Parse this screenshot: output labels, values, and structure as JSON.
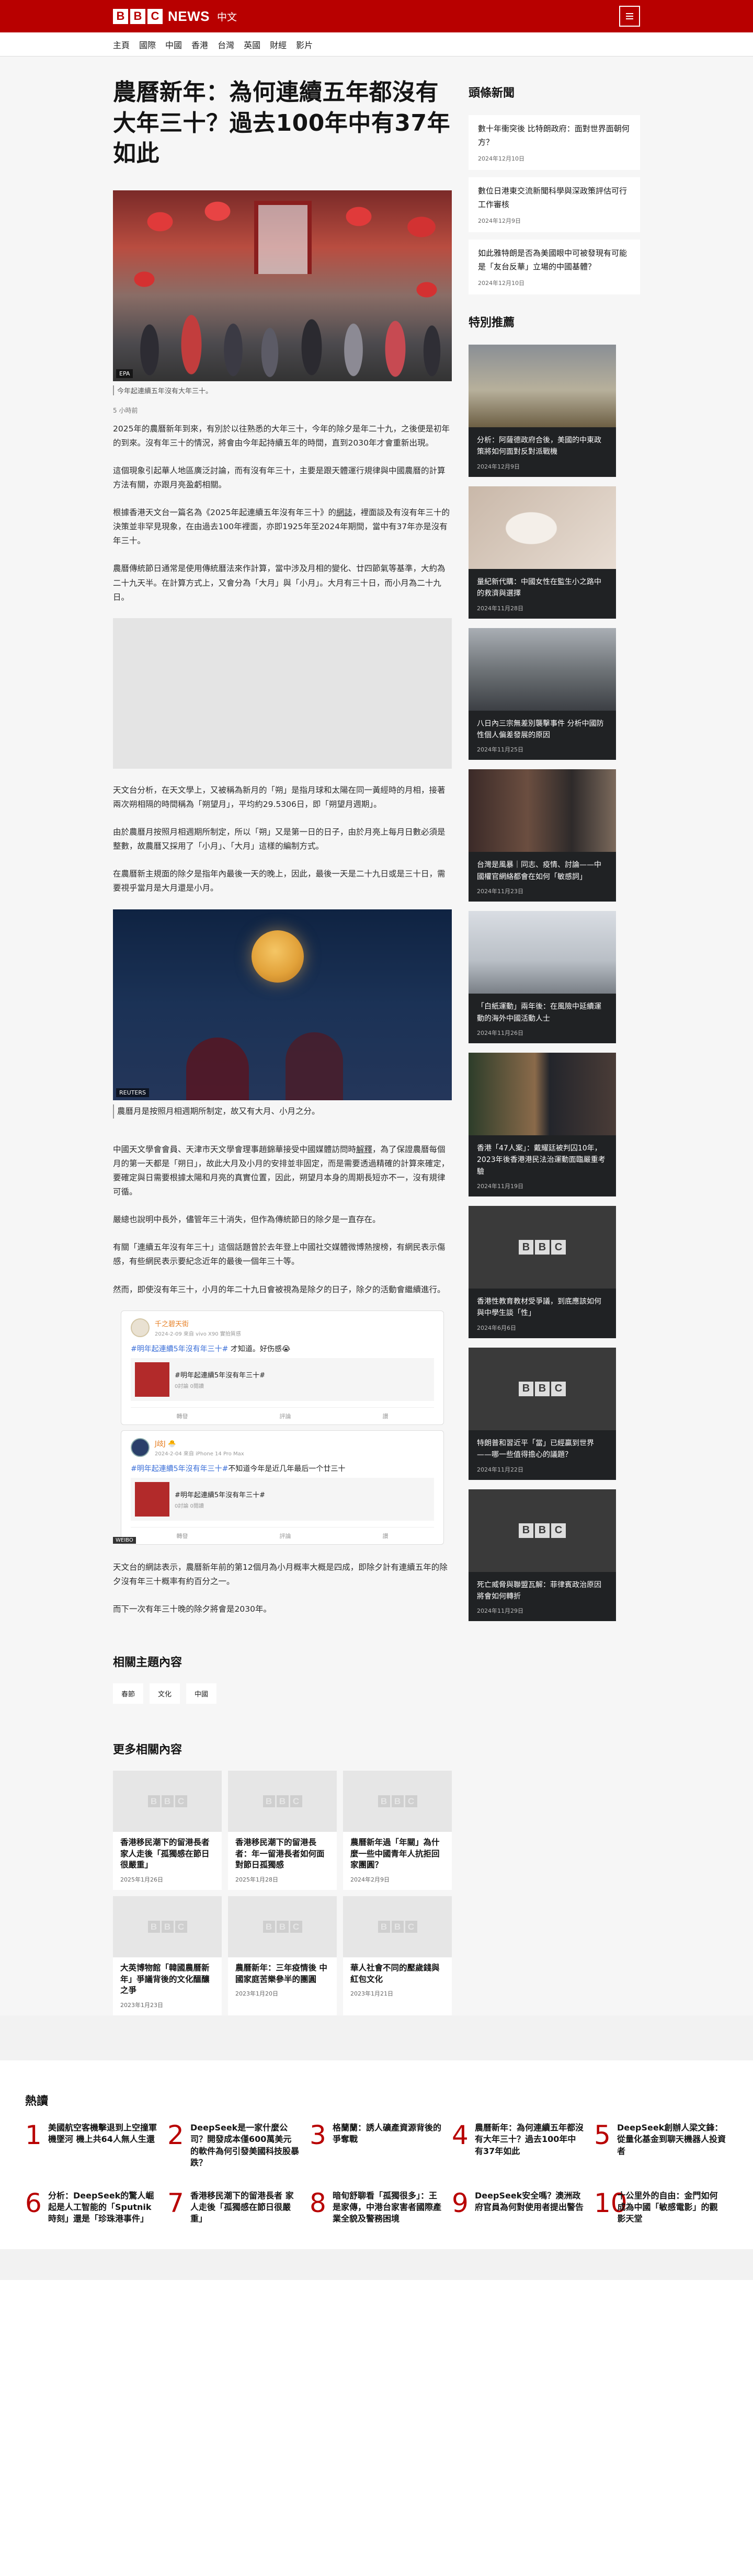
{
  "header": {
    "bbc_letters": [
      "B",
      "B",
      "C"
    ],
    "news_label": "NEWS",
    "lang_label": "中文",
    "menu_icon": "hamburger-icon"
  },
  "nav": [
    "主頁",
    "國際",
    "中國",
    "香港",
    "台灣",
    "英國",
    "財經",
    "影片"
  ],
  "article": {
    "title": "農曆新年：為何連續五年都沒有大年三十？過去100年中有37年如此",
    "hero_credit": "EPA",
    "hero_caption": "今年起連續五年沒有大年三十。",
    "byline": "5 小時前",
    "paragraphs_a": [
      "2025年的農曆新年到來，有別於以往熟悉的大年三十，今年的除夕是年二十九，之後便是初年的到來。沒有年三十的情況，將會由今年起持續五年的時間，直到2030年才會重新出現。",
      "這個現象引起華人地區廣泛討論，而有沒有年三十，主要是跟天體運行規律與中國農曆的計算方法有關，亦跟月亮盈虧相關。",
      "根據香港天文台一篇名為《2025年起連續五年沒有年三十》的",
      "網誌",
      "，裡面談及有沒有年三十的決策並非罕見現象，在由過去100年裡面，亦即1925年至2024年期間，當中有37年亦是沒有年三十。",
      "農曆傳統節日通常是使用傳統曆法來作計算，當中涉及月相的變化、廿四節氣等基準，大約為二十九天半。在計算方式上，又會分為「大月」與「小月」。大月有三十日，而小月為二十九日。"
    ],
    "paragraphs_b": [
      "天文台分析，在天文學上，又被稱為新月的「朔」是指月球和太陽在同一黃經時的月相，接著兩次朔相隔的時間稱為「朔望月」，平均約29.5306日，即「朔望月週期」。",
      "由於農曆月按照月相週期所制定，所以「朔」又是第一日的日子，由於月亮上每月日數必須是整數，故農曆又採用了「小月」、「大月」這樣的編制方式。",
      "在農曆新主規面的除夕是指年內最後一天的晚上，因此，最後一天是二十九日或是三十日，需要視乎當月是大月還是小月。"
    ],
    "moon_credit": "REUTERS",
    "moon_caption": "農曆月是按照月相週期所制定，故又有大月、小月之分。",
    "paragraphs_c": [
      "中國天文學會會員、天津市天文學會理事趙錦華接受中國媒體訪問時",
      "解釋",
      "，為了保證農曆每個月的第一天都是「朔日」，故此大月及小月的安排並非固定，而是需要透過精確的計算來確定，要確定與日需要根據太陽和月亮的真實位置，因此，朔望月本身的周期長短亦不一，沒有規律可循。",
      "嚴總也說明中長外，儘管年三十消失，但作為傳統節日的除夕是一直存在。",
      "有關「連續五年沒有年三十」這個話題曾於去年登上中國社交媒體微博熱搜榜，有網民表示傷感，有些網民表示要紀念近年的最後一個年三十等。",
      "然而，即使沒有年三十，小月的年二十九日會被視為是除夕的日子，除夕的活動會繼續進行。"
    ],
    "embeds": [
      {
        "user": "千之碧天街",
        "meta": "2024-2-09 來自 vivo X90 實拍質感",
        "tag": "#明年起連續5年沒有年三十#",
        "text": " 才知道。好伤感😭",
        "card_title": "#明年起連續5年沒有年三十#",
        "card_sub": "0討論 0閱讀",
        "forward": "轉發",
        "comment": "評論",
        "like": "讚"
      },
      {
        "user": "J歧J 🐣",
        "meta": "2024-2-04 來自 iPhone 14 Pro Max",
        "tag": "#明年起連續5年沒有年三十#",
        "text": "不知道今年是近几年最后一个廿三十",
        "card_title": "#明年起連續5年沒有年三十#",
        "card_sub": "0討論 0閱讀",
        "forward": "轉發",
        "comment": "評論",
        "like": "讚"
      }
    ],
    "weibo_label": "WEIBO",
    "paragraphs_d": [
      "天文台的網誌表示，農曆新年前的第12個月為小月概率大概是四成，即除夕計有連續五年的除夕沒有年三十概率有約百分之一。",
      "而下一次有年三十晚的除夕將會是2030年。"
    ]
  },
  "topics": {
    "title": "相關主題內容",
    "tags": [
      "春節",
      "文化",
      "中國"
    ]
  },
  "related": {
    "title": "更多相關內容",
    "items": [
      {
        "title": "香港移民潮下的留港長者 家人走後「孤獨感在節日很嚴重」",
        "date": "2025年1月26日"
      },
      {
        "title": "香港移民潮下的留港長者：年一留港長者如何面對節日孤獨感",
        "date": "2025年1月28日"
      },
      {
        "title": "農曆新年過「年關」為什麼一些中國青年人抗拒回家團圓？",
        "date": "2024年2月9日"
      },
      {
        "title": "大英博物館「韓國農曆新年」爭議背後的文化醞釀之爭",
        "date": "2023年1月23日"
      },
      {
        "title": "農曆新年：三年疫情後 中國家庭苦樂參半的團圓",
        "date": "2023年1月20日"
      },
      {
        "title": "華人社會不同的壓歲錢與紅包文化",
        "date": "2023年1月21日"
      }
    ]
  },
  "sidebar": {
    "headlines_title": "頭條新聞",
    "headlines": [
      {
        "title": "數十年衝突後 比特朗政府：面對世界面朝何方？",
        "date": "2024年12月10日"
      },
      {
        "title": "數位日港東交流新聞科學與深政策評估可行工作審核",
        "date": "2024年12月9日"
      },
      {
        "title": "如此雅特朗是否為美國眼中可被發現有可能是「友台反華」立場的中國基體？",
        "date": "2024年12月10日"
      }
    ],
    "featured_title": "特別推薦",
    "featured": [
      {
        "title": "分析：阿薩德政府合後，美國的中東政策將如何面對反對派戰機",
        "date": "2024年12月9日"
      },
      {
        "title": "量紀新代購：中國女性在監生小之路中的救濟與選擇",
        "date": "2024年11月28日"
      },
      {
        "title": "八日內三宗無差別襲擊事件 分析中國防性個人偏差發展的原因",
        "date": "2024年11月25日"
      },
      {
        "title": "台灣是風暴｜同志、疫情、討論——中國權官網絡都會在如何「敏感詞」",
        "date": "2024年11月23日"
      },
      {
        "title": "「白紙運動」兩年後：在風險中延續運動的海外中國活動人士",
        "date": "2024年11月26日"
      },
      {
        "title": "香港「47人案」：戴耀廷被判囚10年，2023年後香港港民法治運動面臨嚴重考驗",
        "date": "2024年11月19日"
      },
      {
        "title": "香港性教育教材受爭議，到底應該如何與中學生談「性」",
        "date": "2024年6月6日"
      },
      {
        "title": "特朗普和習近平「當」已經贏到世界——哪一些值得擔心的議題？",
        "date": "2024年11月22日"
      },
      {
        "title": "死亡威脅與聯盟瓦解：菲律賓政治原因將會如何轉折",
        "date": "2024年11月29日"
      }
    ]
  },
  "mostread": {
    "title": "熱讀",
    "items": [
      {
        "num": "1",
        "title": "美國航空客機擊退到上空撞軍機墜河 機上共64人無人生還"
      },
      {
        "num": "2",
        "title": "DeepSeek是一家什麼公司？開發成本僅600萬美元的軟件為何引發美國科技股暴跌？"
      },
      {
        "num": "3",
        "title": "格蘭蘭：誘人礦產資源背後的爭奪戰"
      },
      {
        "num": "4",
        "title": "農曆新年：為何連續五年都沒有大年三十？過去100年中有37年如此"
      },
      {
        "num": "5",
        "title": "DeepSeek創辦人梁文鋒：從量化基金到聊天機器人投資者"
      },
      {
        "num": "6",
        "title": "分析：DeepSeek的驚人崛起是人工智能的「Sputnik時刻」還是「珍珠港事件」"
      },
      {
        "num": "7",
        "title": "香港移民潮下的留港長者 家人走後「孤獨感在節日很嚴重」"
      },
      {
        "num": "8",
        "title": "暗旬舒聊看「孤獨很多」：王是家傳，中港台家害者國際產業全貌及警務困境"
      },
      {
        "num": "9",
        "title": "DeepSeek安全嗎？澳洲政府官員為何對使用者提出警告"
      },
      {
        "num": "10",
        "title": "十公里外的自由：金門如何成為中國「敏感電影」的觀影天堂"
      }
    ]
  }
}
